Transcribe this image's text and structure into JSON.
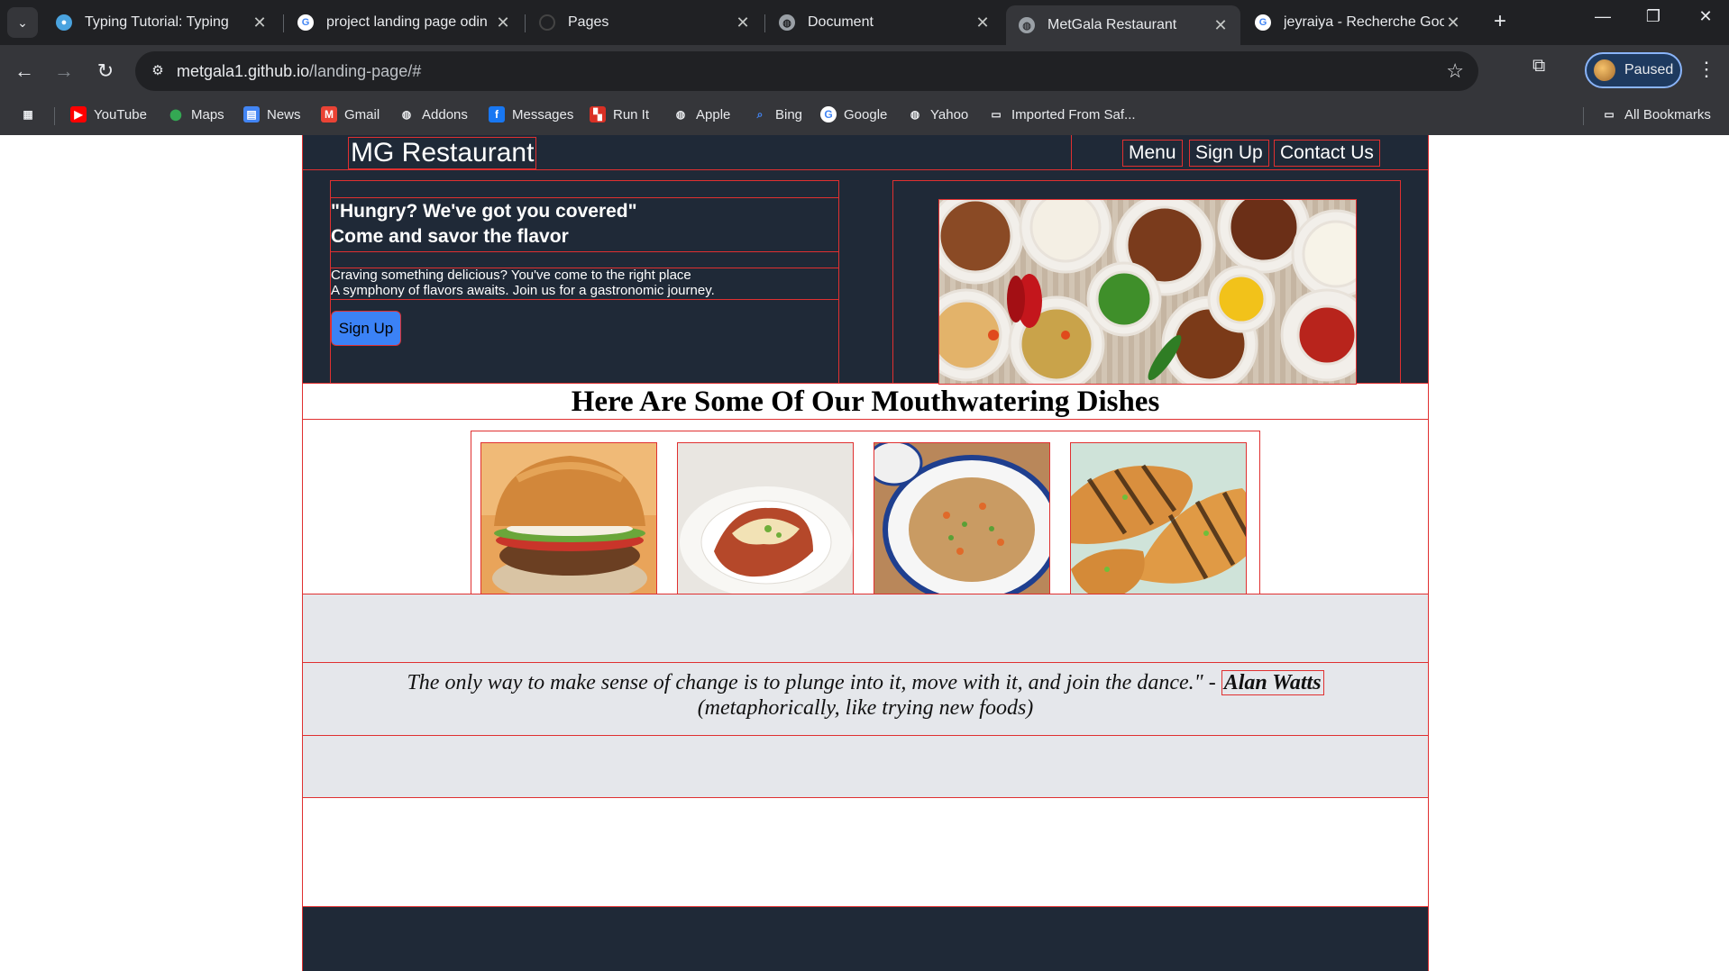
{
  "browser": {
    "tabs": [
      {
        "title": "Typing Tutorial: Typing"
      },
      {
        "title": "project landing page odin"
      },
      {
        "title": "Pages"
      },
      {
        "title": "Document"
      },
      {
        "title": "MetGala Restaurant"
      },
      {
        "title": "jeyraiya - Recherche Googl"
      }
    ],
    "url_host": "metgala1.github.io",
    "url_path": "/landing-page/#",
    "profile_label": "Paused",
    "bookmarks": [
      "YouTube",
      "Maps",
      "News",
      "Gmail",
      "Addons",
      "Messages",
      "Run It",
      "Apple",
      "Bing",
      "Google",
      "Yahoo",
      "Imported From Saf..."
    ],
    "all_bookmarks": "All Bookmarks"
  },
  "site": {
    "logo": "MG Restaurant",
    "nav": [
      "Menu",
      "Sign Up",
      "Contact Us"
    ],
    "hero": {
      "tagline_1": "\"Hungry? We've got you covered\"",
      "tagline_2": "Come and savor the flavor",
      "blurb_1": "Craving something delicious? You've come to the right place",
      "blurb_2": "A symphony of flavors awaits. Join us for a gastronomic journey.",
      "cta": "Sign Up"
    },
    "dishes_title": "Here Are Some Of Our Mouthwatering Dishes",
    "quote": {
      "text": "The only way to make sense of change is to plunge into it, move with it, and join the dance.\" -",
      "author": "Alan Watts",
      "note": "(metaphorically, like trying new foods)"
    }
  }
}
